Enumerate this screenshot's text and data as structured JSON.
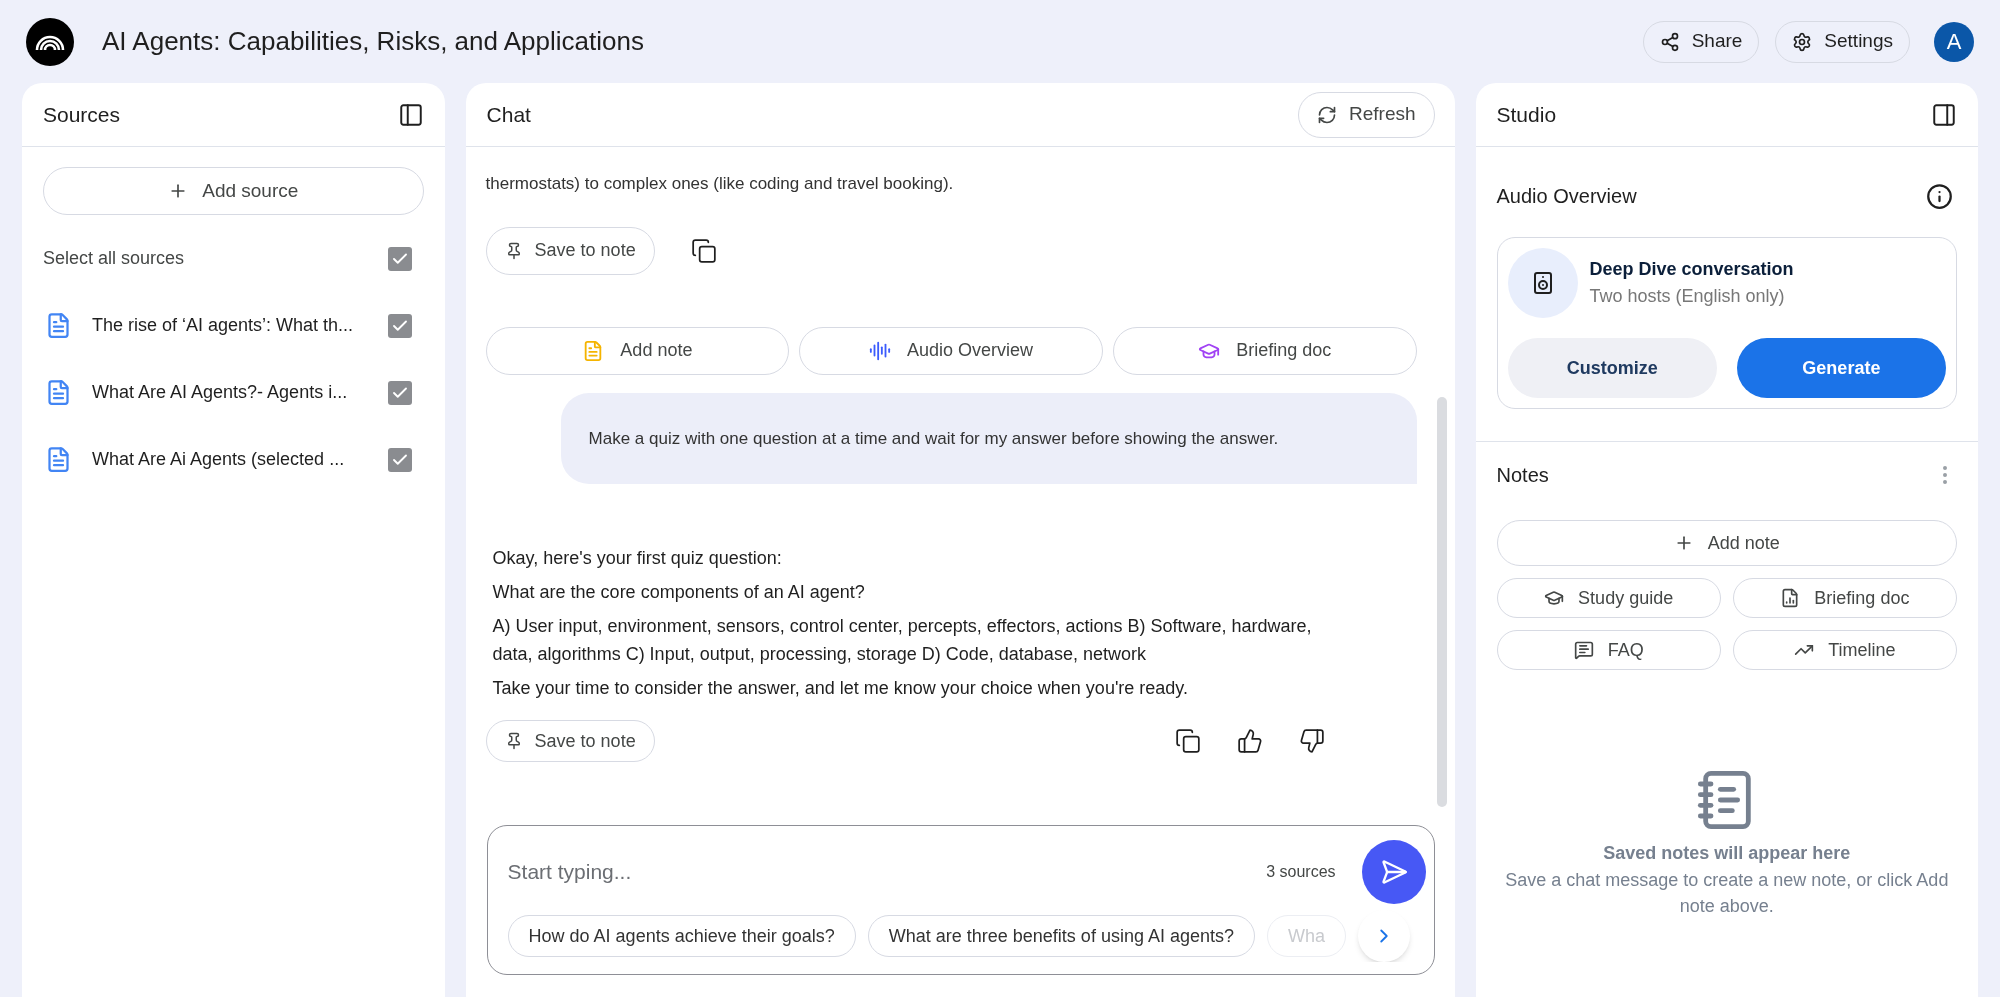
{
  "header": {
    "title": "AI Agents: Capabilities, Risks, and Applications",
    "buttons": [
      {
        "label": "Share",
        "kind": "share"
      },
      {
        "label": "Settings",
        "kind": "settings"
      }
    ],
    "avatar": "A"
  },
  "sources": {
    "title": "Sources",
    "add_button": "Add source",
    "select_all": {
      "label": "Select all sources",
      "checked": true
    },
    "items": [
      {
        "title": "The rise of ‘AI agents’: What th...",
        "checked": true
      },
      {
        "title": "What Are AI Agents?- Agents i...",
        "checked": true
      },
      {
        "title": "What Are Ai Agents (selected ...",
        "checked": true
      }
    ]
  },
  "chat": {
    "title": "Chat",
    "refresh": "Refresh",
    "earlier_response": {
      "paragraphs": [
        "thermostats) to complex ones (like coding and travel booking)."
      ],
      "save_label": "Save to note"
    },
    "quick_actions": [
      {
        "label": "Add note",
        "kind": "note"
      },
      {
        "label": "Audio Overview",
        "kind": "audio"
      },
      {
        "label": "Briefing doc",
        "kind": "briefing"
      }
    ],
    "user_message": "Make a quiz with one question at a time and wait for my answer before showing the answer.",
    "response": {
      "paragraphs": [
        "Okay, here's your first quiz question:",
        "What are the core components of an AI agent?",
        "A) User input, environment, sensors, control center, percepts, effectors, actions B) Software, hardware, data, algorithms C) Input, output, processing, storage D) Code, database, network",
        "Take your time to consider the answer, and let me know your choice when you're ready."
      ],
      "save_label": "Save to note"
    },
    "input": {
      "placeholder": "Start typing...",
      "source_count": "3 sources",
      "suggestions": [
        {
          "label": "How do AI agents achieve their goals?",
          "faded": false
        },
        {
          "label": "What are three benefits of using AI agents?",
          "faded": false
        },
        {
          "label": "Wha",
          "faded": true
        }
      ]
    }
  },
  "studio": {
    "title": "Studio",
    "audio_overview": {
      "title": "Audio Overview",
      "card_title": "Deep Dive conversation",
      "card_subtitle": "Two hosts (English only)",
      "buttons": [
        {
          "label": "Customize",
          "kind": "secondary"
        },
        {
          "label": "Generate",
          "kind": "primary"
        }
      ]
    },
    "notes": {
      "title": "Notes",
      "add_button": "Add note",
      "tools": [
        {
          "label": "Study guide",
          "kind": "study"
        },
        {
          "label": "Briefing doc",
          "kind": "briefing"
        },
        {
          "label": "FAQ",
          "kind": "faq"
        },
        {
          "label": "Timeline",
          "kind": "timeline"
        }
      ],
      "empty_title": "Saved notes will appear here",
      "empty_text": "Save a chat message to create a new note, or click Add note above."
    }
  }
}
